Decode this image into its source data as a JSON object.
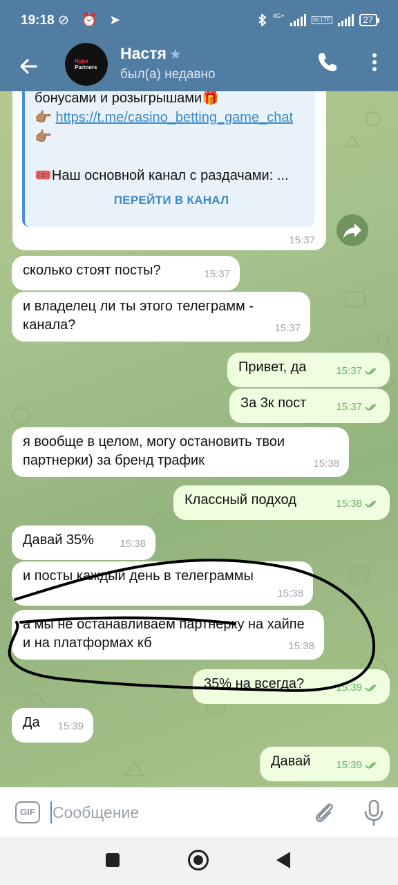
{
  "status_bar": {
    "time": "19:18",
    "left_icons": "⊘ ⏰ ➤",
    "network": "4G+",
    "volte": "Vo LTE",
    "battery": "27"
  },
  "header": {
    "avatar_line1": "Hype",
    "avatar_line2": "Partners",
    "name": "Настя",
    "status": "был(а) недавно"
  },
  "channel_post": {
    "line1": "бонусами и розыгрышами🎁",
    "line2_prefix": "👉🏽 ",
    "link": "https://t.me/casino_betting_game_chat",
    "line3": "👉🏽",
    "line4": "🎟️Наш основной канал с раздачами: ...",
    "button": "ПЕРЕЙТИ В КАНАЛ",
    "time": "15:37"
  },
  "messages": [
    {
      "side": "in",
      "text": "сколько стоят посты?",
      "time": "15:37"
    },
    {
      "side": "in",
      "text": "и владелец ли ты этого телеграмм - канала?",
      "time": "15:37"
    },
    {
      "side": "out",
      "text": "Привет, да",
      "time": "15:37"
    },
    {
      "side": "out",
      "text": "За 3к пост",
      "time": "15:37"
    },
    {
      "side": "in",
      "text": "я вообще в целом, могу остановить твои партнерки) за бренд трафик",
      "time": "15:38"
    },
    {
      "side": "out",
      "text": "Классный подход",
      "time": "15:38"
    },
    {
      "side": "in",
      "text": "Давай 35%",
      "time": "15:38"
    },
    {
      "side": "in",
      "text": "и посты каждый день в телеграммы",
      "time": "15:38"
    },
    {
      "side": "in",
      "text": "а мы не останавливаем партнерку на хайпе и на платформах кб",
      "time": "15:38"
    },
    {
      "side": "out",
      "text": "35% на всегда?",
      "time": "15:39"
    },
    {
      "side": "in",
      "text": "Да",
      "time": "15:39"
    },
    {
      "side": "out",
      "text": "Давай",
      "time": "15:39"
    }
  ],
  "input": {
    "gif_label": "GIF",
    "placeholder": "Сообщение"
  },
  "colors": {
    "header": "#527da3",
    "incoming_bubble": "#ffffff",
    "outgoing_bubble": "#eefedf",
    "link": "#3b89c7",
    "read_checks": "#6bb362"
  }
}
